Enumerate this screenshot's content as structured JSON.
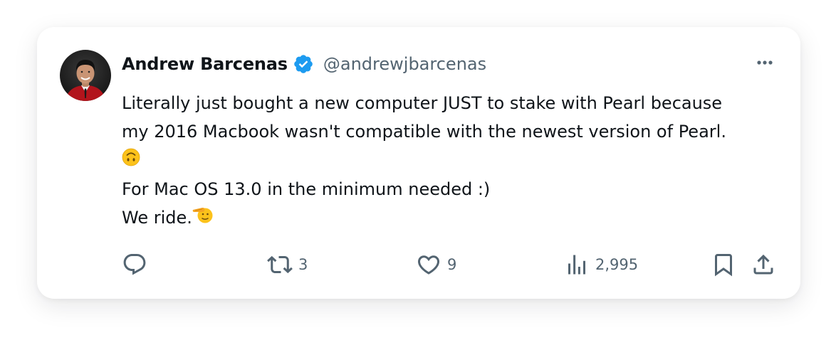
{
  "tweet": {
    "author": {
      "name": "Andrew Barcenas",
      "handle": "@andrewjbarcenas",
      "verified": true,
      "verified_color": "#1d9bf0"
    },
    "body": {
      "line1": "Literally just bought a new computer JUST to stake with Pearl because",
      "line2": "my 2016 Macbook wasn't compatible with the newest version of Pearl.",
      "line3_emoji": "upside-down-face",
      "line4": "For Mac OS 13.0 in the minimum needed :)",
      "line5": "We ride.",
      "line5_emoji": "saluting-face"
    },
    "actions": {
      "reply": {
        "icon": "reply-icon",
        "count": ""
      },
      "retweet": {
        "icon": "retweet-icon",
        "count": "3"
      },
      "like": {
        "icon": "heart-icon",
        "count": "9"
      },
      "views": {
        "icon": "views-chart-icon",
        "count": "2,995"
      },
      "bookmark": {
        "icon": "bookmark-icon"
      },
      "share": {
        "icon": "share-icon"
      }
    },
    "menu_icon": "more-options-icon"
  },
  "colors": {
    "text_primary": "#0f1419",
    "text_secondary": "#536471",
    "icon": "#536471",
    "background": "#ffffff"
  }
}
